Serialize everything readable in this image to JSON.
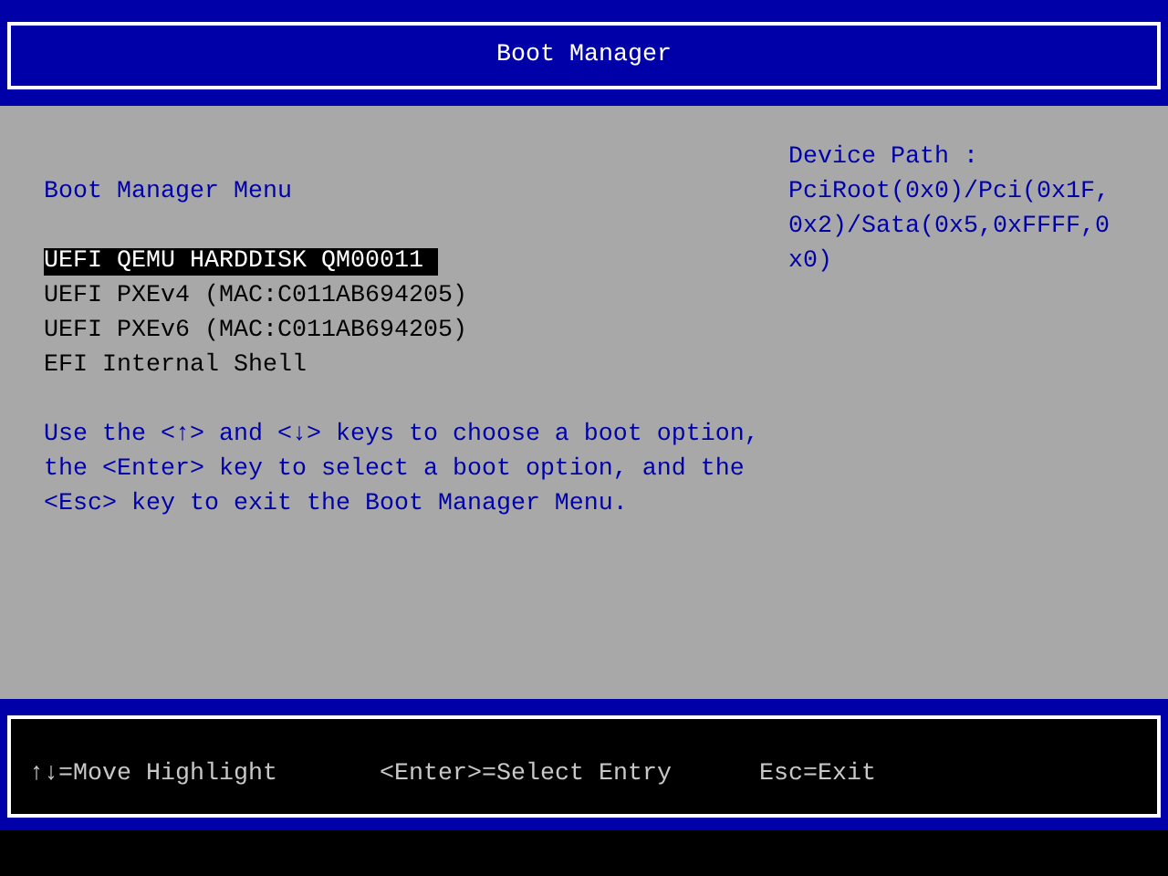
{
  "title": "Boot Manager",
  "menu": {
    "heading": "Boot Manager Menu",
    "items": [
      {
        "label": "UEFI QEMU HARDDISK QM00011",
        "selected": true
      },
      {
        "label": "UEFI PXEv4 (MAC:C011AB694205)",
        "selected": false
      },
      {
        "label": "UEFI PXEv6 (MAC:C011AB694205)",
        "selected": false
      },
      {
        "label": "EFI Internal Shell",
        "selected": false
      }
    ],
    "help_lines": [
      "Use the <↑> and <↓> keys to choose a boot option,",
      "the <Enter> key to select a boot option, and the",
      "<Esc> key to exit the Boot Manager Menu."
    ]
  },
  "device_path": {
    "heading": "Device Path :",
    "lines": [
      "PciRoot(0x0)/Pci(0x1F,",
      "0x2)/Sata(0x5,0xFFFF,0",
      "x0)"
    ]
  },
  "footer": [
    "↑↓=Move Highlight",
    "<Enter>=Select Entry",
    "Esc=Exit"
  ]
}
